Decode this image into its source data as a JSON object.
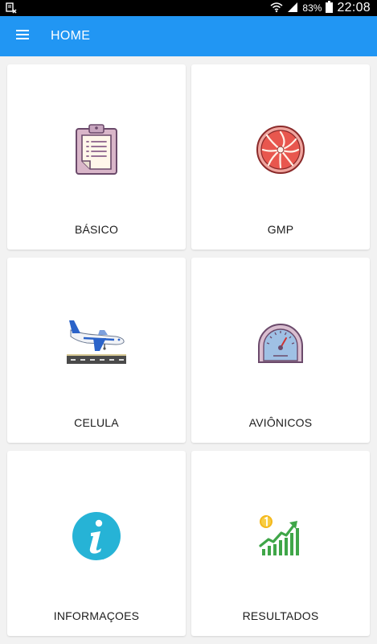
{
  "status_bar": {
    "battery_percent": "83%",
    "time": "22:08"
  },
  "app_bar": {
    "title": "HOME",
    "menu_icon": "hamburger-menu-icon"
  },
  "cards": [
    {
      "label": "BÁSICO",
      "icon": "clipboard-checklist-icon"
    },
    {
      "label": "GMP",
      "icon": "turbine-engine-icon"
    },
    {
      "label": "CELULA",
      "icon": "airplane-landing-icon"
    },
    {
      "label": "AVIÔNICOS",
      "icon": "gauge-dial-icon"
    },
    {
      "label": "INFORMAÇOES",
      "icon": "info-icon"
    },
    {
      "label": "RESULTADOS",
      "icon": "growth-chart-icon"
    }
  ],
  "colors": {
    "app_bar": "#2196f3",
    "background": "#f2f2f2",
    "card": "#ffffff"
  }
}
